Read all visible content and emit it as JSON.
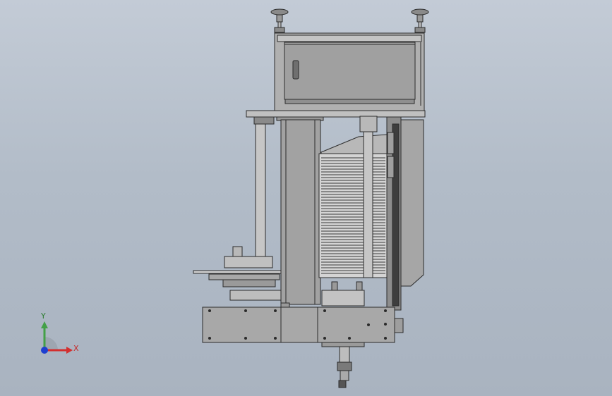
{
  "triad": {
    "x_label": "X",
    "y_label": "Y",
    "colors": {
      "x": "#d32f2f",
      "y": "#43a047",
      "z": "#1e3fd0"
    }
  },
  "colors": {
    "background_top": "#c3cbd6",
    "background_bottom": "#a9b3c0",
    "part_fill": "#a4a4a4",
    "part_fill_light": "#c8c8c8",
    "edge": "#2b2b2b"
  }
}
